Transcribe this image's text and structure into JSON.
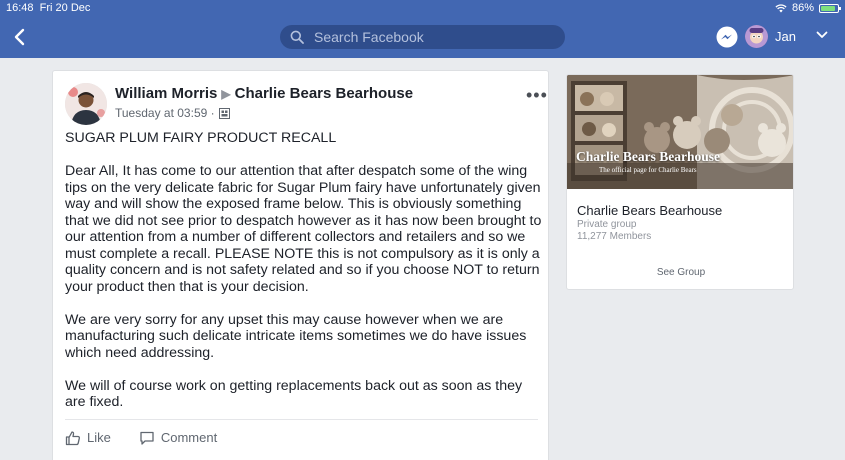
{
  "status_bar": {
    "time": "16:48",
    "date": "Fri 20 Dec",
    "battery_percent": "86%",
    "battery_level": 0.86
  },
  "nav": {
    "search_placeholder": "Search Facebook",
    "user_name": "Jan",
    "bar_color": "#4267b2"
  },
  "post": {
    "author": "William Morris",
    "group": "Charlie Bears Bearhouse",
    "timestamp": "Tuesday at 03:59 ·",
    "title": "SUGAR PLUM FAIRY PRODUCT RECALL",
    "paragraphs": [
      "Dear All, It has come to our attention that after despatch some of the wing tips on the very delicate fabric for Sugar Plum fairy have unfortunately given way and will show the exposed frame below. This is obviously something that we did not see prior to despatch however as it has now been brought to our attention from a number of different collectors and retailers and so we must complete a recall. PLEASE NOTE this is not compulsory as it is only a quality concern and is not safety related and so if you choose NOT to return your product then that is your decision.",
      "We are very sorry for any upset this may cause however when we are manufacturing such delicate intricate items sometimes we do have issues which need addressing.",
      "We will of course work on getting replacements back out as soon as they are fixed."
    ],
    "actions": {
      "like": "Like",
      "comment": "Comment"
    }
  },
  "group_card": {
    "cover_title": "Charlie Bears Bearhouse",
    "cover_subtitle": "The official page for Charlie Bears",
    "name": "Charlie Bears Bearhouse",
    "privacy": "Private group",
    "members": "11,277 Members",
    "see_group": "See Group"
  }
}
